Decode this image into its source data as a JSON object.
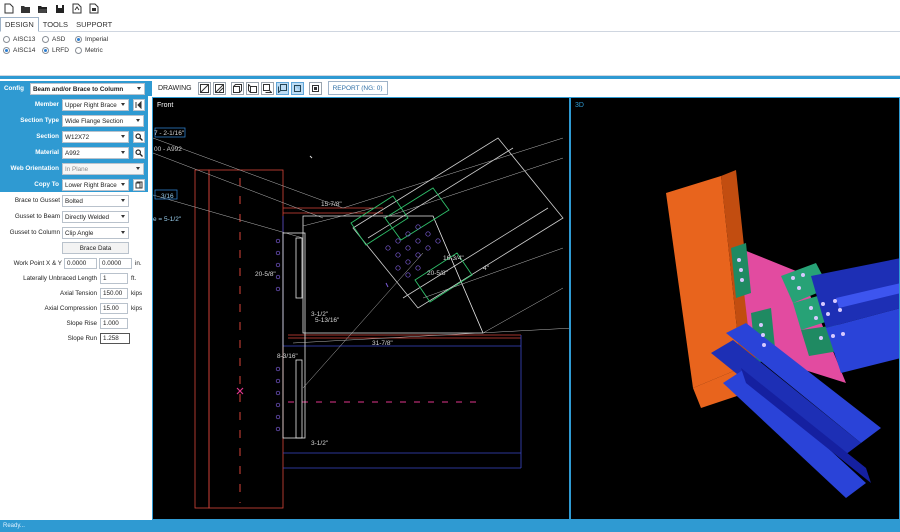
{
  "ribbon": {
    "tabs": [
      {
        "label": "DESIGN",
        "active": true
      },
      {
        "label": "TOOLS",
        "active": false
      },
      {
        "label": "SUPPORT",
        "active": false
      }
    ],
    "spec": {
      "aisc13": "AISC13",
      "aisc14": "AISC14",
      "selected": "AISC14"
    },
    "method": {
      "asd": "ASD",
      "lrfd": "LRFD",
      "selected": "LRFD"
    },
    "units": {
      "imperial": "Imperial",
      "metric": "Metric",
      "selected": "Imperial"
    }
  },
  "panel": {
    "config_label": "Config",
    "config_value": "Beam and/or Brace to Column",
    "member_label": "Member",
    "member_value": "Upper Right Brace",
    "section_type_label": "Section Type",
    "section_type_value": "Wide Flange Section",
    "section_label": "Section",
    "section_value": "W12X72",
    "material_label": "Material",
    "material_value": "A992",
    "web_orientation_label": "Web Orientation",
    "web_orientation_value": "In Plane",
    "copy_to_label": "Copy To",
    "copy_to_value": "Lower Right Brace",
    "brace_to_gusset_label": "Brace to Gusset",
    "brace_to_gusset_value": "Bolted",
    "gusset_to_beam_label": "Gusset to Beam",
    "gusset_to_beam_value": "Directly Welded",
    "gusset_to_column_label": "Gusset to Column",
    "gusset_to_column_value": "Clip Angle",
    "brace_data_button": "Brace Data",
    "work_point_label": "Work Point X & Y",
    "work_point_x": "0.0000",
    "work_point_y": "0.0000",
    "work_point_unit": "in.",
    "unbraced_label": "Laterally Unbraced Length",
    "unbraced_value": "1",
    "unbraced_unit": "ft.",
    "axial_tension_label": "Axial Tension",
    "axial_tension_value": "150.00",
    "axial_tension_unit": "kips",
    "axial_compression_label": "Axial Compression",
    "axial_compression_value": "15.00",
    "axial_compression_unit": "kips",
    "slope_rise_label": "Slope Rise",
    "slope_rise_value": "1.000",
    "slope_run_label": "Slope Run",
    "slope_run_value": "1.258"
  },
  "toolbar": {
    "drawing_label": "DRAWING",
    "report_label": "REPORT (NG: 0)"
  },
  "views": {
    "front_label": "Front",
    "three_d_label": "3D"
  },
  "dims": {
    "d1": "7 - 2-1/16\"",
    "d2": "00 - A992",
    "d3": "3/16",
    "d4": "e = 5-1/2\"",
    "d5": "15-7/8\"",
    "d6": "20-5/8\"",
    "d7": "3-1/2\"",
    "d8": "5-13/16\"",
    "d9": "31-7/8\"",
    "d10": "8-3/16\"",
    "d11": "3-1/2\"",
    "d12": "20-5/8\"",
    "d13": "16-3/4\"",
    "d14": "4\""
  },
  "status": {
    "text": "Ready..."
  },
  "icons": [
    "new-icon",
    "open-icon",
    "open-folder-icon",
    "save-icon",
    "pdf-icon",
    "print-icon"
  ]
}
